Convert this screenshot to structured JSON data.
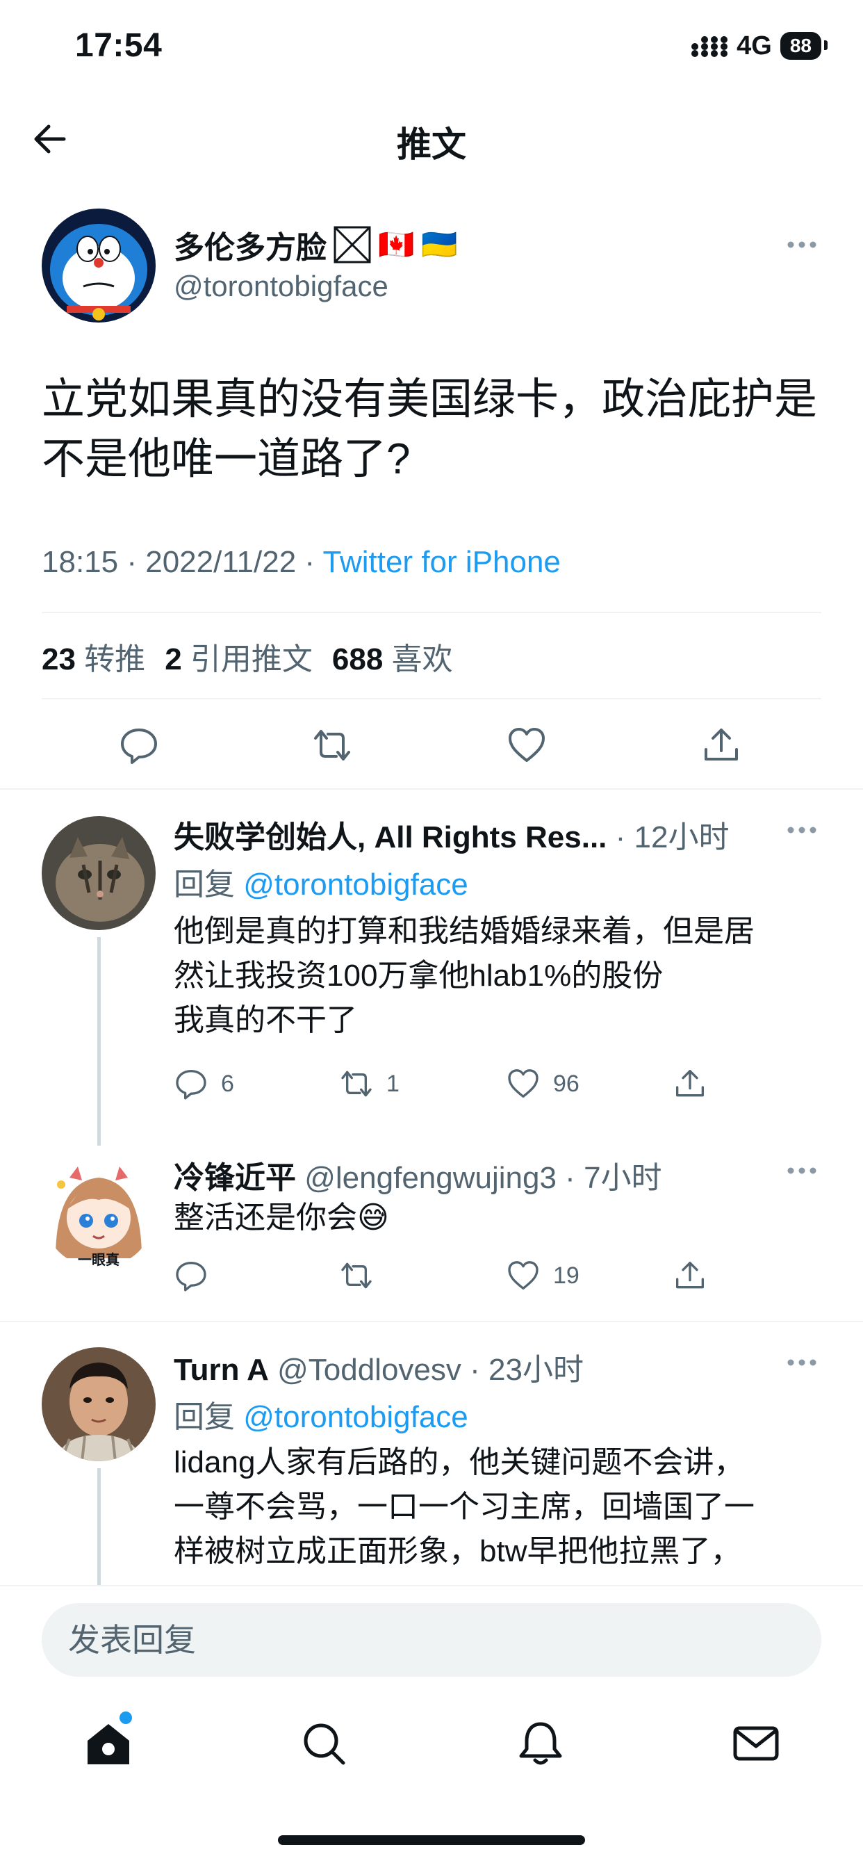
{
  "status_bar": {
    "time": "17:54",
    "network": "4G",
    "battery": "88"
  },
  "header": {
    "title": "推文"
  },
  "tweet": {
    "author_name": "多伦多方脸",
    "flags": [
      "🇨🇦",
      "🇺🇦"
    ],
    "handle": "@torontobigface",
    "text": "立党如果真的没有美国绿卡，政治庇护是不是他唯一道路了?",
    "time": "18:15",
    "date": "2022/11/22",
    "source": "Twitter for iPhone",
    "stats": {
      "retweets": "23",
      "retweets_label": "转推",
      "quotes": "2",
      "quotes_label": "引用推文",
      "likes": "688",
      "likes_label": "喜欢"
    }
  },
  "replies": [
    {
      "name": "失败学创始人, All Rights Res...",
      "handle": "",
      "time": "12小时",
      "reply_prefix": "回复",
      "reply_to": "@torontobigface",
      "text_lines": [
        "他倒是真的打算和我结婚婚绿来着，但是居",
        "然让我投资100万拿他hlab1%的股份",
        "我真的不干了"
      ],
      "counts": {
        "replies": "6",
        "retweets": "1",
        "likes": "96"
      }
    },
    {
      "name": "冷锋近平",
      "handle": "@lengfengwujing3",
      "time": "7小时",
      "avatar_caption": "一眼真",
      "text": "整活还是你会😅",
      "counts": {
        "replies": "",
        "retweets": "",
        "likes": "19"
      }
    },
    {
      "name": "Turn A",
      "handle": "@Toddlovesv",
      "time": "23小时",
      "reply_prefix": "回复",
      "reply_to": "@torontobigface",
      "text_lines": [
        "lidang人家有后路的，他关键问题不会讲，",
        "一尊不会骂，一口一个习主席，回墙国了一",
        "样被树立成正面形象，btw早把他拉黑了，"
      ]
    }
  ],
  "compose": {
    "placeholder": "发表回复"
  },
  "colors": {
    "accent": "#1d9bf0",
    "text": "#0f1419",
    "muted": "#536471",
    "divider": "#eff3f4"
  },
  "icons": [
    "back-arrow-icon",
    "reply-icon",
    "retweet-icon",
    "like-icon",
    "share-icon",
    "more-icon",
    "home-icon",
    "search-icon",
    "notifications-icon",
    "messages-icon"
  ]
}
